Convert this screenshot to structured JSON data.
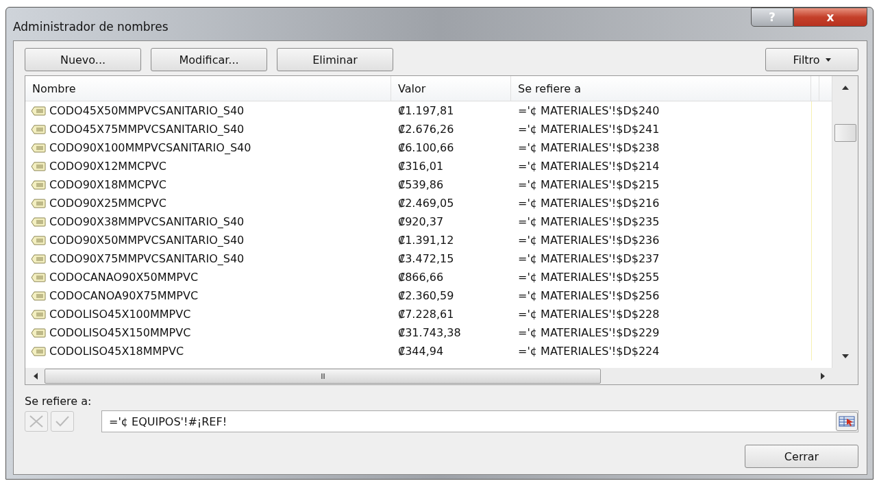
{
  "window": {
    "title": "Administrador de nombres",
    "help_label": "?",
    "close_label": "x"
  },
  "toolbar": {
    "buttons": [
      "Nuevo...",
      "Modificar...",
      "Eliminar"
    ],
    "filter": "Filtro"
  },
  "table": {
    "columns": [
      "Nombre",
      "Valor",
      "Se refiere a"
    ],
    "rows": [
      {
        "name": "CODO45X50MMPVCSANITARIO_S40",
        "value": "₡1.197,81",
        "ref": "='¢ MATERIALES'!$D$240"
      },
      {
        "name": "CODO45X75MMPVCSANITARIO_S40",
        "value": "₡2.676,26",
        "ref": "='¢ MATERIALES'!$D$241"
      },
      {
        "name": "CODO90X100MMPVCSANITARIO_S40",
        "value": "₡6.100,66",
        "ref": "='¢ MATERIALES'!$D$238"
      },
      {
        "name": "CODO90X12MMCPVC",
        "value": "₡316,01",
        "ref": "='¢ MATERIALES'!$D$214"
      },
      {
        "name": "CODO90X18MMCPVC",
        "value": "₡539,86",
        "ref": "='¢ MATERIALES'!$D$215"
      },
      {
        "name": "CODO90X25MMCPVC",
        "value": "₡2.469,05",
        "ref": "='¢ MATERIALES'!$D$216"
      },
      {
        "name": "CODO90X38MMPVCSANITARIO_S40",
        "value": "₡920,37",
        "ref": "='¢ MATERIALES'!$D$235"
      },
      {
        "name": "CODO90X50MMPVCSANITARIO_S40",
        "value": "₡1.391,12",
        "ref": "='¢ MATERIALES'!$D$236"
      },
      {
        "name": "CODO90X75MMPVCSANITARIO_S40",
        "value": "₡3.472,15",
        "ref": "='¢ MATERIALES'!$D$237"
      },
      {
        "name": "CODOCANAO90X50MMPVC",
        "value": "₡866,66",
        "ref": "='¢ MATERIALES'!$D$255"
      },
      {
        "name": "CODOCANOA90X75MMPVC",
        "value": "₡2.360,59",
        "ref": "='¢ MATERIALES'!$D$256"
      },
      {
        "name": "CODOLISO45X100MMPVC",
        "value": "₡7.228,61",
        "ref": "='¢ MATERIALES'!$D$228"
      },
      {
        "name": "CODOLISO45X150MMPVC",
        "value": "₡31.743,38",
        "ref": "='¢ MATERIALES'!$D$229"
      },
      {
        "name": "CODOLISO45X18MMPVC",
        "value": "₡344,94",
        "ref": "='¢ MATERIALES'!$D$224"
      }
    ],
    "h_scroll_grip": "III"
  },
  "refers_to": {
    "label": "Se refiere a:",
    "value": "='¢ EQUIPOS'!#¡REF!"
  },
  "close_button": "Cerrar"
}
